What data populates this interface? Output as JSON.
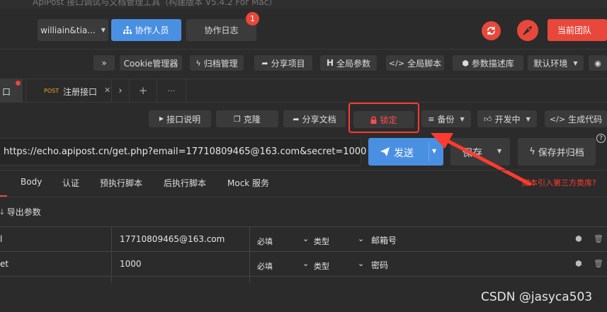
{
  "window": {
    "title": "ApiPost 接口调试与文档管理工具（构建版本 V5.4.2 For Mac）"
  },
  "header": {
    "user_dropdown": "williain&tia...",
    "collaborators_button": "协作人员",
    "collab_log_button": "协作日志",
    "collab_log_badge": "1",
    "current_team_button": "当前团队"
  },
  "toolbar": {
    "expand_label": "»",
    "cookie_manager": "Cookie管理器",
    "archive_manage": "归档管理",
    "share_project": "分享项目",
    "global_params": "全局参数",
    "global_script": "全局脚本",
    "param_desc_lib": "参数描述库",
    "default_env": "默认环境"
  },
  "tabs": {
    "active_tab_label": "口",
    "post_method": "POST",
    "register_tab_label": "注册接口",
    "add_tab": "+",
    "more_tabs": "···"
  },
  "actions": {
    "api_doc": "接口说明",
    "clone": "克隆",
    "share_doc": "分享文档",
    "lock": "锁定",
    "backup": "备份",
    "status": "开发中",
    "gen_code": "生成代码"
  },
  "request": {
    "url": "https://echo.apipost.cn/get.php?email=17710809465@163.com&secret=1000",
    "send": "发送",
    "save": "保存",
    "save_archive": "保存并归档",
    "help": "?"
  },
  "annotation": {
    "text": "脚本引入第三方类库?"
  },
  "subtabs": [
    "Body",
    "认证",
    "预执行脚本",
    "后执行脚本",
    "Mock 服务"
  ],
  "params": {
    "export_label": "导出参数",
    "rows": [
      {
        "key": "l",
        "value": "17710809465@163.com",
        "required": "必填",
        "type": "类型",
        "desc": "邮箱号"
      },
      {
        "key": "et",
        "value": "1000",
        "required": "必填",
        "type": "类型",
        "desc": "密码"
      }
    ]
  },
  "watermark": "CSDN @jasyca503",
  "colors": {
    "accent_blue": "#4a90e2",
    "team_red": "#e8483b",
    "annotation_red": "#ff3b30",
    "background": "#2b2b2b"
  }
}
